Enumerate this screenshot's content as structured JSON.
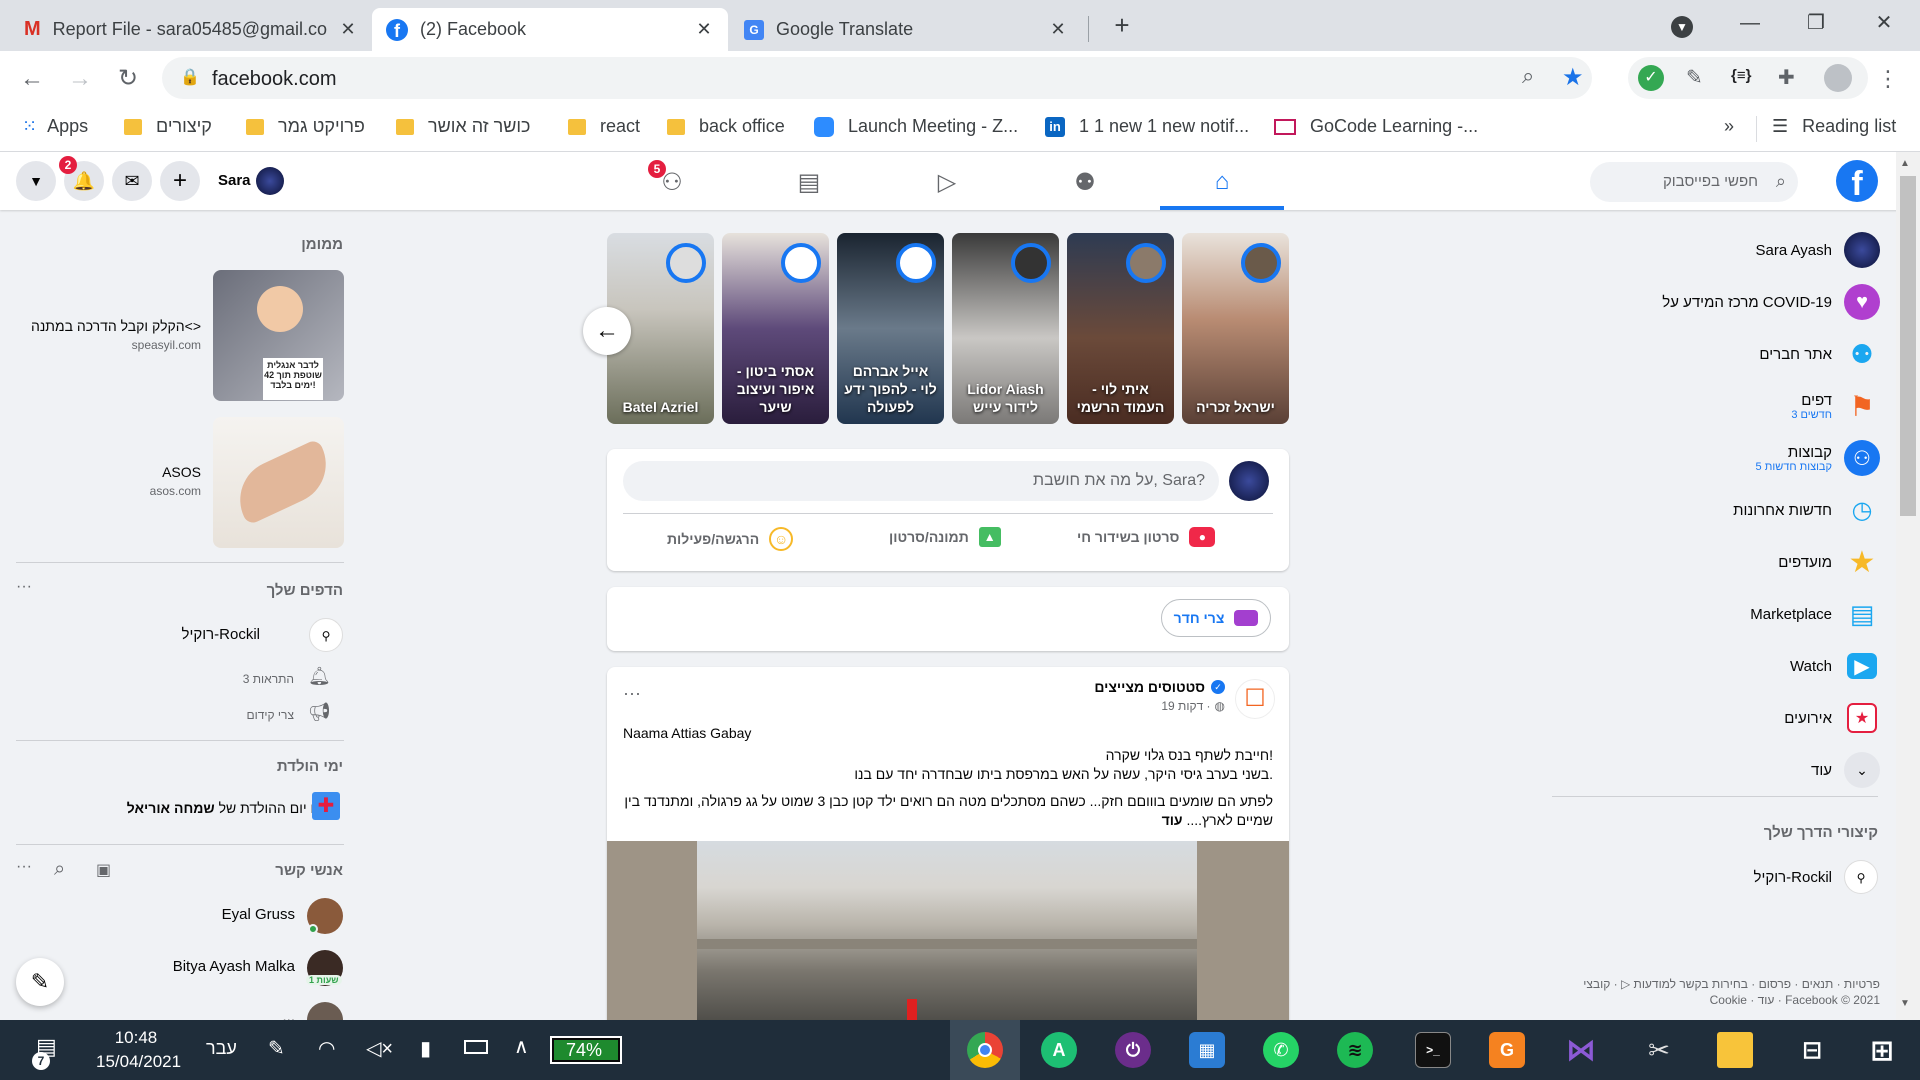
{
  "browser": {
    "tabs": [
      {
        "title": "Report File - sara05485@gmail.co",
        "icon": "gmail-icon"
      },
      {
        "title": "(2) Facebook",
        "icon": "facebook-icon"
      },
      {
        "title": "Google Translate",
        "icon": "google-translate-icon"
      }
    ],
    "url": "facebook.com",
    "bookmarks": [
      "Apps",
      "קיצורים",
      "פרויקט גמר",
      "כושר זה אושר",
      "react",
      "back office",
      "Launch Meeting - Z...",
      "1 1 new 1 new notif...",
      "GoCode Learning -...",
      "Reading list"
    ],
    "bookmarks_more": "»"
  },
  "fb": {
    "user_short": "Sara",
    "notif_count": "2",
    "groups_badge": "5",
    "search_placeholder": "חפשי בפייסבוק",
    "right_nav": [
      {
        "label": "Sara Ayash",
        "sub": ""
      },
      {
        "label": "מרכז המידע על COVID-19",
        "sub": ""
      },
      {
        "label": "אתר חברים",
        "sub": ""
      },
      {
        "label": "דפים",
        "sub": "3 חדשים"
      },
      {
        "label": "קבוצות",
        "sub": "5 קבוצות חדשות"
      },
      {
        "label": "חדשות אחרונות",
        "sub": ""
      },
      {
        "label": "מועדפים",
        "sub": ""
      },
      {
        "label": "Marketplace",
        "sub": ""
      },
      {
        "label": "Watch",
        "sub": ""
      },
      {
        "label": "אירועים",
        "sub": ""
      },
      {
        "label": "עוד",
        "sub": ""
      }
    ],
    "shortcuts_title": "קיצורי הדרך שלך",
    "shortcut": "רוקיל-Rockil",
    "footer1": "פרטיות · תנאים · פרסום · בחירות בקשר למודעות ▷ · קובצי",
    "footer2": "Cookie · עוד · Facebook © 2021",
    "sponsored_title": "ממומן",
    "ads": [
      {
        "title": "הקלק וקבל הדרכה במתנה<>",
        "site": "speasyil.com",
        "img_text": "לדבר אנגלית שוטפת תוך 42 ימים בלבד!"
      },
      {
        "title": "ASOS",
        "site": "asos.com"
      }
    ],
    "your_pages_title": "הדפים שלך",
    "page_name": "רוקיל-Rockil",
    "page_notifs": "3 התראות",
    "page_promo": "צרי קידום",
    "birthdays_title": "ימי הולדת",
    "birthday_prefix": "היום יום ההולדת של",
    "birthday_name": "שמחה אוריאל.",
    "contacts_title": "אנשי קשר",
    "contacts": [
      {
        "name": "Eyal Gruss",
        "sub": ""
      },
      {
        "name": "Bitya Ayash Malka",
        "sub": "1 שעות"
      },
      {
        "name": "...",
        "sub": ""
      }
    ],
    "more_dots": "···",
    "stories": [
      {
        "name": "Batel Azriel"
      },
      {
        "name": "אסתי ביטון - איפור ועיצוב שיער"
      },
      {
        "name": "אייל אברהם לוי - להפוך ידע לפעולה"
      },
      {
        "name": "Lidor Aiash לידור עייש"
      },
      {
        "name": "איתי לוי - העמוד הרשמי"
      },
      {
        "name": "ישראל זכריה"
      }
    ],
    "composer": {
      "placeholder": "על מה את חושבת, Sara?",
      "live": "סרטון בשידור חי",
      "photo": "תמונה/סרטון",
      "feeling": "הרגשה/פעילות"
    },
    "room_button": "צרי חדר",
    "post": {
      "page": "סטטוסים מצייצים",
      "time": "19 דקות ·",
      "author": "Naama Attias Gabay",
      "line1": "חייבת לשתף בנס גלוי שקרה!",
      "line2": "בשני בערב גיסי היקר, עשה על האש במרפסת ביתו שבחדרה יחד עם בנו.",
      "line3": "לפתע הם שומעים בוווםם חזק... כשהם מסתכלים מטה הם רואים ילד קטן כבן 3 שמוט על גג פרגולה, ומתנדנד בין שמיים לארץ....",
      "more": "עוד"
    }
  },
  "taskbar": {
    "time": "10:48",
    "date": "15/04/2021",
    "lang": "עבר",
    "battery": "74%",
    "notif": "7"
  },
  "colors": {
    "fb_blue": "#1877f2",
    "taskbar": "#1f2d3a"
  }
}
